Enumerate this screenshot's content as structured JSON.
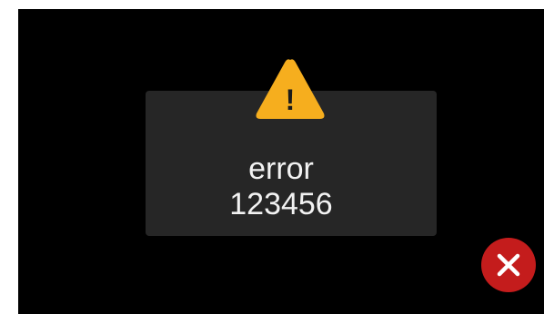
{
  "dialog": {
    "title": "error",
    "code": "123456",
    "icon": "warning-triangle-icon",
    "icon_symbol": "!",
    "close_icon": "close-icon"
  },
  "colors": {
    "background": "#000000",
    "card": "#262626",
    "warning": "#f6ae1e",
    "close": "#c41c1c",
    "text": "#f2f2f2"
  }
}
